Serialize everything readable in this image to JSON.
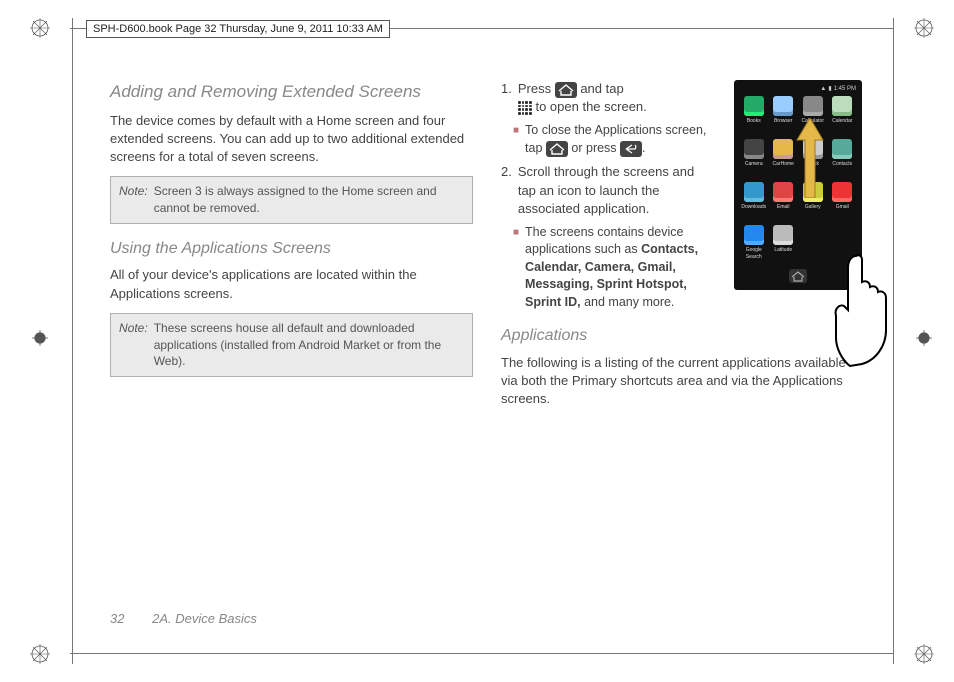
{
  "header": "SPH-D600.book  Page 32  Thursday, June 9, 2011  10:33 AM",
  "left": {
    "h1": "Adding and Removing Extended Screens",
    "p1": "The device comes by default with a Home screen and four extended screens. You can add up to two additional extended screens for a total of seven screens.",
    "note1_label": "Note:",
    "note1_text": "Screen 3 is always assigned to the Home screen and cannot be removed.",
    "h2": "Using the Applications Screens",
    "p2": "All of your device's applications are located within the Applications screens.",
    "note2_label": "Note:",
    "note2_text": "These screens house all default and downloaded applications (installed from Android Market or from the Web)."
  },
  "right": {
    "step1a": "Press",
    "step1b": "and tap",
    "step1c": "to open the screen.",
    "sub1a": "To close the Applications screen, tap",
    "sub1b": "or press",
    "step2": "Scroll through the screens and tap an icon to launch the associated application.",
    "sub2a": "The screens contains device applications such as ",
    "apps_bold": "Contacts, Calendar, Camera, Gmail, Messaging, Sprint Hotspot, Sprint ID,",
    "sub2b": " and many more.",
    "h_apps": "Applications",
    "p_apps": "The following is a listing of the current applications available via both the Primary shortcuts area and via the Applications screens."
  },
  "phone": {
    "time": "1:45 PM",
    "apps": [
      {
        "label": "Books",
        "bg": "#2a6",
        "ic": "#2e7"
      },
      {
        "label": "Browser",
        "bg": "#9cf",
        "ic": "#69c"
      },
      {
        "label": "Calculator",
        "bg": "#888",
        "ic": "#aaa"
      },
      {
        "label": "Calendar",
        "bg": "#bdb",
        "ic": "#8b8"
      },
      {
        "label": "Camera",
        "bg": "#444",
        "ic": "#888"
      },
      {
        "label": "CarHome",
        "bg": "#e5b84a",
        "ic": "#c99"
      },
      {
        "label": "Clock",
        "bg": "#ccc",
        "ic": "#999"
      },
      {
        "label": "Contacts",
        "bg": "#5a9",
        "ic": "#8cb"
      },
      {
        "label": "Downloads",
        "bg": "#39c",
        "ic": "#6bd"
      },
      {
        "label": "Email",
        "bg": "#d44",
        "ic": "#f77"
      },
      {
        "label": "Gallery",
        "bg": "#cc3",
        "ic": "#ee6"
      },
      {
        "label": "Gmail",
        "bg": "#e33",
        "ic": "#f66"
      },
      {
        "label": "Google Search",
        "bg": "#28e",
        "ic": "#5af"
      },
      {
        "label": "Latitude",
        "bg": "#bbb",
        "ic": "#ddd"
      },
      {
        "label": "",
        "bg": "transparent",
        "ic": "transparent"
      },
      {
        "label": "",
        "bg": "transparent",
        "ic": "transparent"
      }
    ]
  },
  "footer": {
    "page": "32",
    "section": "2A. Device Basics"
  }
}
